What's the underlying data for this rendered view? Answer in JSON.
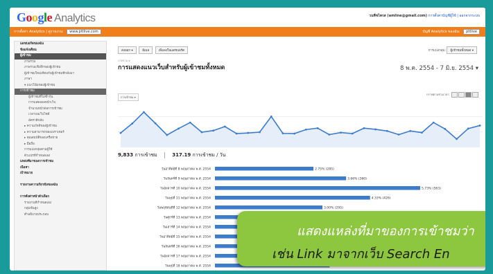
{
  "header": {
    "logo_google": [
      "G",
      "o",
      "o",
      "g",
      "l",
      "e"
    ],
    "logo_product": "Analytics",
    "account": "วนพืชไพรส (amline@gmail.com)",
    "links": "การตั้งค่าบัญชีผู้ใช้ | ออกจากระบบ"
  },
  "orange_bar": {
    "left_label": "การตั้งค่า Analytics | ดูรายงาน:",
    "site_select": "www.pttlive.com",
    "right_label": "บัญชี Analytics ของฉัน:",
    "account_select": "pttlive"
  },
  "sidebar": {
    "items": [
      {
        "label": "แดชบอร์ดของฉัน",
        "cls": "sec"
      },
      {
        "label": "ข้อแจ้งเตือน",
        "cls": "sec"
      },
      {
        "label": "ผู้เข้าชม",
        "cls": "hl"
      },
      {
        "label": "ภาพรวม",
        "cls": "sub"
      },
      {
        "label": "ภาพรวมเชิงลึกของผู้เข้าชม",
        "cls": "sub"
      },
      {
        "label": "ผู้เข้าชมใหม่เทียบกับผู้เข้าชมที่กลับมา",
        "cls": "sub"
      },
      {
        "label": "ภาษา",
        "cls": "sub"
      },
      {
        "label": "▾ แนวโน้มของผู้เข้าชม",
        "cls": "sub"
      },
      {
        "label": "การเข้าชม",
        "cls": "active"
      },
      {
        "label": "ผู้เข้าชมที่ไม่ซ้ำกัน",
        "cls": "sub2"
      },
      {
        "label": "การแสดงผลหน้าเว็บ",
        "cls": "sub2"
      },
      {
        "label": "จำนวนหน้าต่อการเข้าชม",
        "cls": "sub2"
      },
      {
        "label": "เวลาบนเว็บไซต์",
        "cls": "sub2"
      },
      {
        "label": "อัตราตีกลับ",
        "cls": "sub2"
      },
      {
        "label": "▸ ความภักดีของผู้เข้าชม",
        "cls": "sub"
      },
      {
        "label": "▸ ความสามารถของเบราเซอร์",
        "cls": "sub"
      },
      {
        "label": "▸ คุณสมบัติของเครือข่าย",
        "cls": "sub"
      },
      {
        "label": "▸ มือถือ",
        "cls": "sub"
      },
      {
        "label": "การแบ่งกลุ่มตามผู้ใช้",
        "cls": "sub"
      },
      {
        "label": "ตัวแปรที่กำหนดเอง",
        "cls": "sub"
      },
      {
        "label": "แหล่งที่มาของการเข้าชม",
        "cls": "sec"
      },
      {
        "label": "เนื้อหา",
        "cls": "sec"
      },
      {
        "label": "เป้าหมาย",
        "cls": "sec"
      },
      {
        "label": "",
        "cls": ""
      },
      {
        "label": "รายงานความกี่ยวข้อของฉัน",
        "cls": "sec"
      },
      {
        "label": "",
        "cls": ""
      },
      {
        "label": "การตั้งค่าหน้าตัวเลือก",
        "cls": "sec"
      },
      {
        "label": "รายงานที่กำหนดเอง",
        "cls": "sub"
      },
      {
        "label": "กลุ่มขั้นสูง",
        "cls": "sub"
      },
      {
        "label": "คำอธิบายประกอบ",
        "cls": "sub"
      }
    ]
  },
  "toolbar": {
    "buttons": [
      "ส่งออก ▾",
      "อีเมล",
      "เพิ่มลงในแดชบอร์ด"
    ],
    "dropdown": "ผู้เข้าชมทั้งหมด ▾",
    "dropdown_label": "การแบ่งกลุ่ม:"
  },
  "report": {
    "crumb": "ภาพรวม ▸",
    "title": "การแสดงแนวเว็บสำหรับผู้เข้าชมทั้งหมด",
    "date_range": "8 พ.ค. 2554 - 7 มิ.ย. 2554 ▾",
    "graph_option": "การเข้าชม ▾",
    "view_label": "กราฟตามช่วงเวลา:"
  },
  "stats": {
    "visits": "9,833",
    "visits_label": "การเข้าชม",
    "per_day": "317.19",
    "per_day_label": "การเข้าชม / วัน"
  },
  "chart_data": {
    "type": "line",
    "title": "",
    "values": [
      308,
      355,
      412,
      356,
      298,
      330,
      360,
      312,
      320,
      340,
      305,
      308,
      312,
      390,
      306,
      305,
      325,
      332,
      300,
      310,
      305,
      332,
      326,
      318,
      300,
      318,
      310,
      360,
      328,
      278,
      330,
      345
    ],
    "ylim": [
      250,
      450
    ],
    "color": "#3d7cc9",
    "fill": "#e5eef9"
  },
  "bar_data": {
    "type": "bar",
    "rows": [
      {
        "label": "วันอาทิตย์ที่ 8 พฤษภาคม พ.ศ. 2554",
        "value": 2.75,
        "text": "2.75% (285)"
      },
      {
        "label": "วันจันทร์ที่ 9 พฤษภาคม พ.ศ. 2554",
        "value": 3.66,
        "text": "3.66% (360)"
      },
      {
        "label": "วันอังคารที่ 10 พฤษภาคม พ.ศ. 2554",
        "value": 5.73,
        "text": "5.73% (563)"
      },
      {
        "label": "วันพุธที่ 11 พฤษภาคม พ.ศ. 2554",
        "value": 4.33,
        "text": "4.33% (426)"
      },
      {
        "label": "วันพฤหัสบดีที่ 12 พฤษภาคม พ.ศ. 2554",
        "value": 3.0,
        "text": "3.00% (295)"
      },
      {
        "label": "วันศุกร์ที่ 13 พฤษภาคม พ.ศ. 2554",
        "value": 3.1,
        "text": ""
      },
      {
        "label": "วันเสาร์ที่ 14 พฤษภาคม พ.ศ. 2554",
        "value": 3.15,
        "text": ""
      },
      {
        "label": "วันอาทิตย์ที่ 15 พฤษภาคม พ.ศ. 2554",
        "value": 3.2,
        "text": ""
      },
      {
        "label": "วันจันทร์ที่ 16 พฤษภาคม พ.ศ. 2554",
        "value": 3.3,
        "text": ""
      },
      {
        "label": "วันอังคารที่ 17 พฤษภาคม พ.ศ. 2554",
        "value": 3.25,
        "text": ""
      },
      {
        "label": "วันพุธที่ 18 พฤษภาคม พ.ศ. 2554",
        "value": 3.2,
        "text": ""
      }
    ],
    "max": 6.0,
    "color": "#3d7cc9"
  },
  "overlay": {
    "line1": "แสดงแหล่งที่มาของการเข้าชมว่า",
    "line2": "เช่น Link มาจากเว็บ Search En"
  }
}
